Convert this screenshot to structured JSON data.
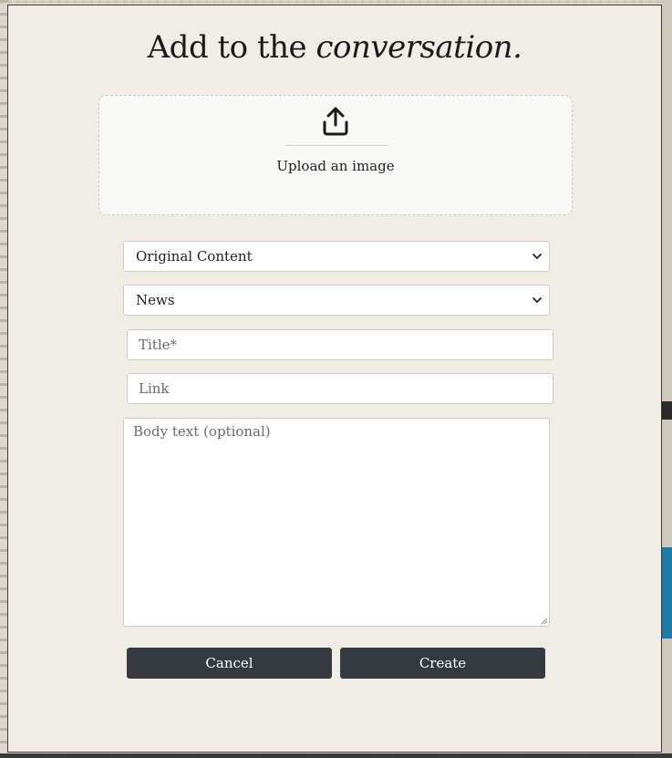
{
  "heading": {
    "prefix": "Add to the ",
    "emphasis": "conversation."
  },
  "upload": {
    "icon": "upload-icon",
    "label": "Upload an image"
  },
  "content_type_select": {
    "selected": "Original Content"
  },
  "category_select": {
    "selected": "News"
  },
  "title_input": {
    "placeholder": "Title*",
    "value": ""
  },
  "link_input": {
    "placeholder": "Link",
    "value": ""
  },
  "body_textarea": {
    "placeholder": "Body text (optional)",
    "value": ""
  },
  "actions": {
    "cancel_label": "Cancel",
    "create_label": "Create"
  },
  "colors": {
    "modal_background": "#f0ede6",
    "button_background": "#343a40",
    "button_text": "#ffffff"
  }
}
